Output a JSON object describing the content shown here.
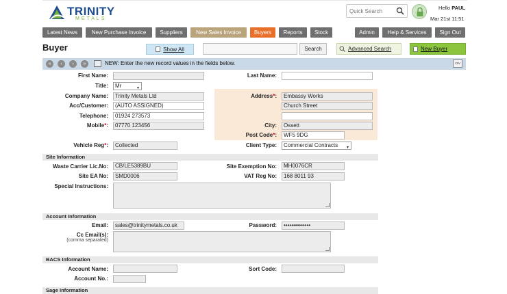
{
  "header": {
    "logo_title": "TRINITY",
    "logo_sub": "METALS",
    "search_placeholder": "Quick Search",
    "hello_prefix": "Hello",
    "user": "PAUL",
    "datetime": "Mar 21st 11:51"
  },
  "nav": {
    "latest_news": "Latest News",
    "new_purchase_invoice": "New Purchase Invoice",
    "suppliers": "Suppliers",
    "new_sales_invoice": "New Sales Invoice",
    "buyers": "Buyers",
    "reports": "Reports",
    "stock": "Stock",
    "admin": "Admin",
    "help": "Help & Services",
    "sign_out": "Sign Out"
  },
  "page": {
    "title": "Buyer",
    "show_all": "Show All",
    "search_button": "Search",
    "advanced_search": "Advanced Search",
    "new_buyer": "New Buyer",
    "toolbar_message": "NEW: Enter the new record values in the fields below.",
    "csv": "csv"
  },
  "form": {
    "labels": {
      "first_name": "First Name:",
      "last_name": "Last Name:",
      "title": "Title:",
      "company_name": "Company Name:",
      "acc_customer": "Acc/Customer:",
      "telephone": "Telephone:",
      "mobile": "Mobile",
      "address": "Address",
      "city": "City:",
      "post_code": "Post Code",
      "vehicle_reg": "Vehicle Reg",
      "client_type": "Client Type:",
      "waste_carrier": "Waste Carrier Lic.No:",
      "site_exemption": "Site Exemption No:",
      "site_ea": "Site EA No:",
      "vat_reg": "VAT Reg No:",
      "special_instructions": "Special Instructions:",
      "email": "Email:",
      "password": "Password:",
      "cc_emails": "Cc Email(s):",
      "cc_sub": "(comma separated)",
      "account_name": "Account Name:",
      "sort_code": "Sort Code:",
      "account_no": "Account No.:"
    },
    "values": {
      "first_name": "",
      "last_name": "",
      "title": "Mr",
      "company_name": "Trinity Metals Ltd",
      "acc_customer": "(AUTO ASSIGNED)",
      "telephone": "01924 273573",
      "mobile": "07770 123456",
      "address_1": "Embassy Works",
      "address_2": "Church Street",
      "address_3": "",
      "address_4": "",
      "city": "Ossett",
      "post_code": "WF5 9DG",
      "vehicle_reg": "Collected",
      "client_type": "Commercial Contracts",
      "waste_carrier": "CB/LE5389BU",
      "site_exemption": "MH0076CR",
      "site_ea": "SMD0006",
      "vat_reg": "168 8011 93",
      "email": "sales@trinitymetals.co.uk",
      "password": "••••••••••••••",
      "account_name": "",
      "sort_code": "",
      "account_no": ""
    },
    "sections": {
      "site": "Site Information",
      "account": "Account Information",
      "bacs": "BACS Information",
      "sage": "Sage Information"
    }
  }
}
